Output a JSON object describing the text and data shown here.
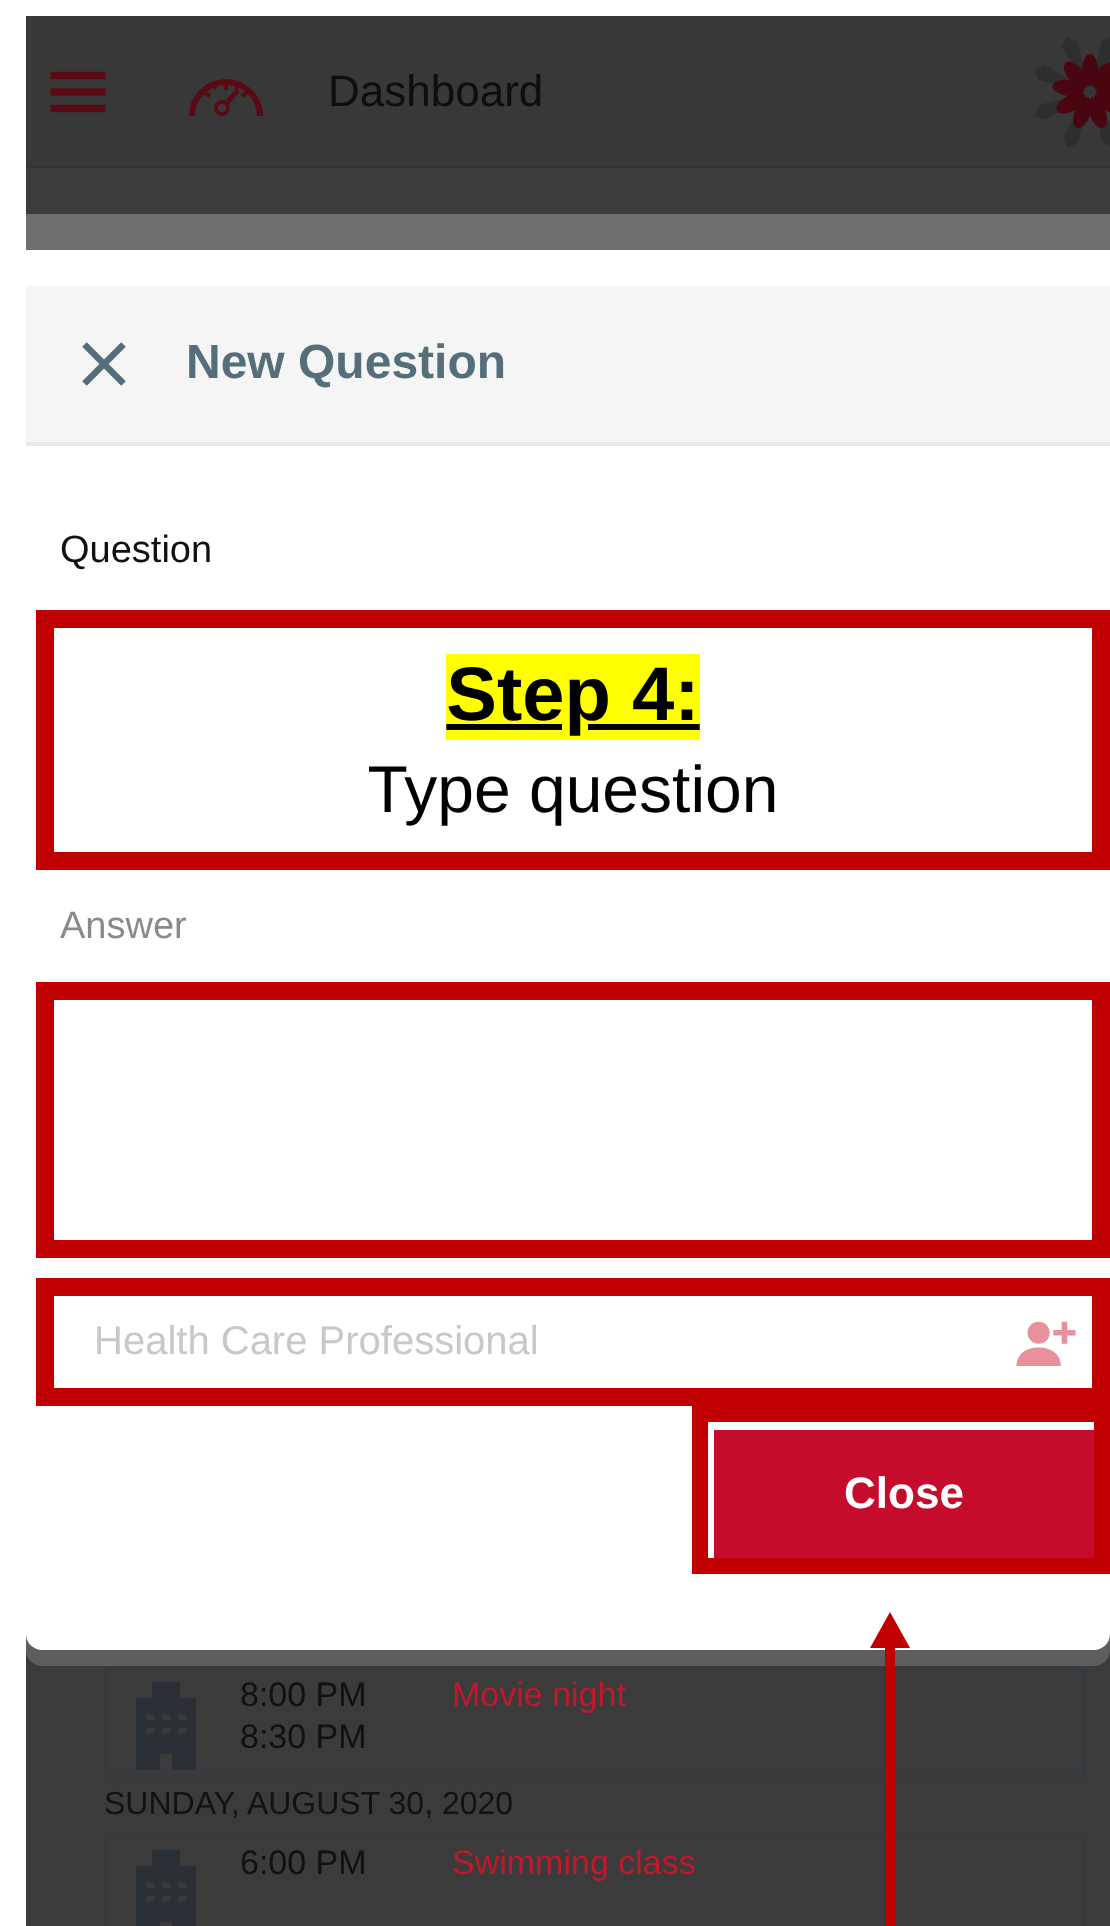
{
  "app_bar": {
    "title": "Dashboard"
  },
  "schedule": [
    {
      "kind": "event",
      "start": "8:00 PM",
      "end": "8:30 PM",
      "title": "Movie night"
    },
    {
      "kind": "date",
      "text": "SUNDAY, AUGUST 30, 2020"
    },
    {
      "kind": "event",
      "start": "6:00 PM",
      "title": "Swimming class"
    }
  ],
  "dialog": {
    "title": "New Question",
    "question_label": "Question",
    "answer_label": "Answer",
    "professional_placeholder": "Health Care Professional",
    "close_button": "Close"
  },
  "annotation": {
    "step": "Step 4:",
    "instruction": "Type question"
  }
}
